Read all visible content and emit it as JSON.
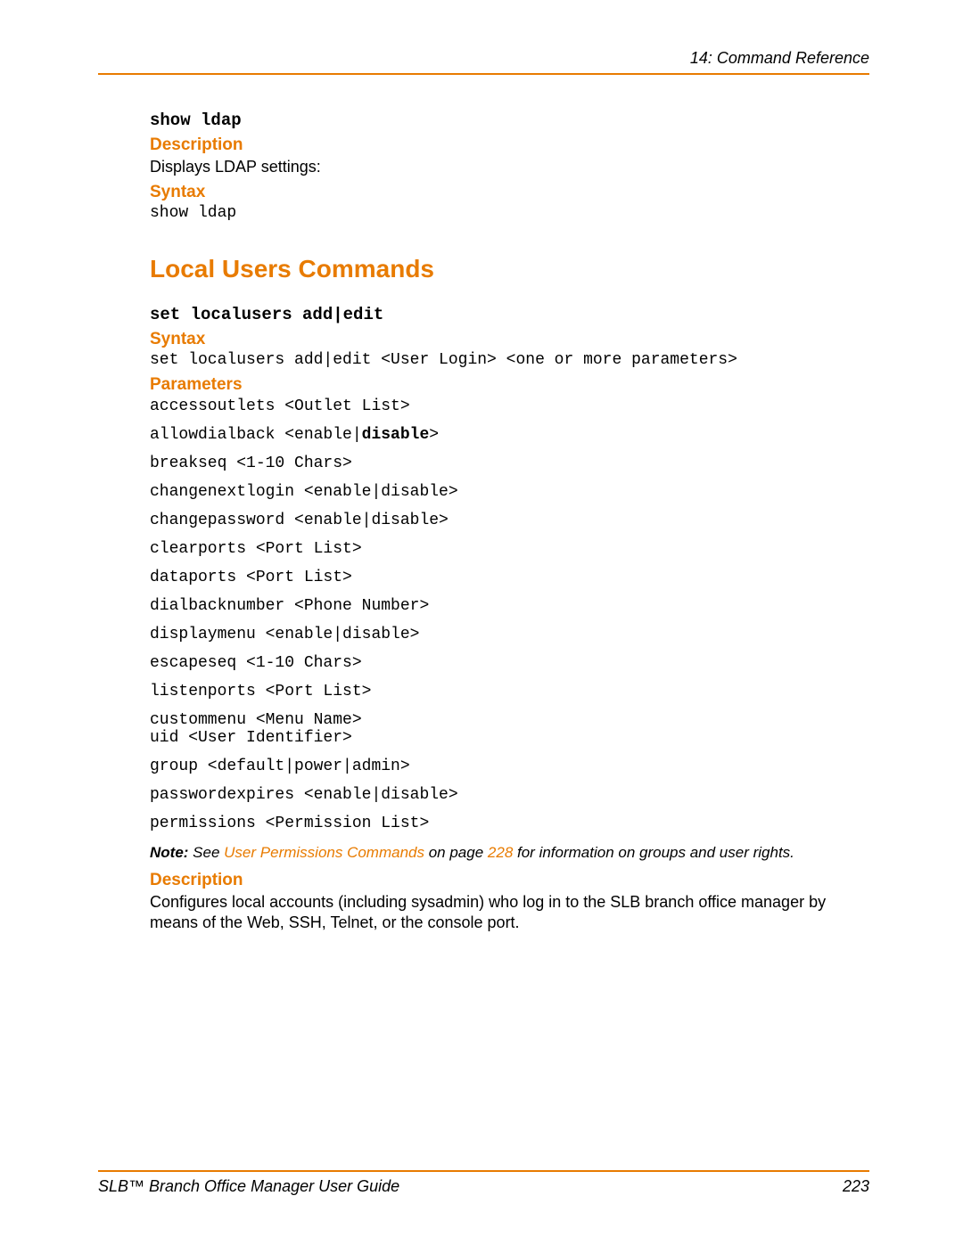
{
  "header": {
    "chapter": "14: Command Reference"
  },
  "cmd1": {
    "name": "show ldap",
    "desc_label": "Description",
    "desc_text": "Displays LDAP settings:",
    "syntax_label": "Syntax",
    "syntax_text": "show ldap"
  },
  "section": {
    "title": "Local Users Commands"
  },
  "cmd2": {
    "name": "set localusers add|edit",
    "syntax_label": "Syntax",
    "syntax_text": "set localusers add|edit <User Login> <one or more parameters>",
    "params_label": "Parameters",
    "params": {
      "p0": "accessoutlets <Outlet List>",
      "p1a": "allowdialback <enable|",
      "p1b": "disable",
      "p1c": ">",
      "p2": "breakseq <1-10 Chars>",
      "p3": "changenextlogin <enable|disable>",
      "p4": "changepassword <enable|disable>",
      "p5": "clearports <Port List>",
      "p6": "dataports <Port List>",
      "p7": "dialbacknumber <Phone Number>",
      "p8": "displaymenu <enable|disable>",
      "p9": "escapeseq <1-10 Chars>",
      "p10": "listenports <Port List>",
      "p11": "custommenu <Menu Name>",
      "p12": "uid <User Identifier>",
      "p13": "group <default|power|admin>",
      "p14": "passwordexpires <enable|disable>",
      "p15": "permissions <Permission List>"
    },
    "note": {
      "label": "Note:",
      "pre": " See ",
      "link": "User Permissions Commands",
      "mid": " on page ",
      "page": "228",
      "post": " for information on groups and user rights."
    },
    "desc_label": "Description",
    "desc_text": "Configures local accounts (including sysadmin) who log in to the SLB branch office manager by means of the Web, SSH, Telnet, or the console port."
  },
  "footer": {
    "title": "SLB™ Branch Office Manager User Guide",
    "page": "223"
  }
}
